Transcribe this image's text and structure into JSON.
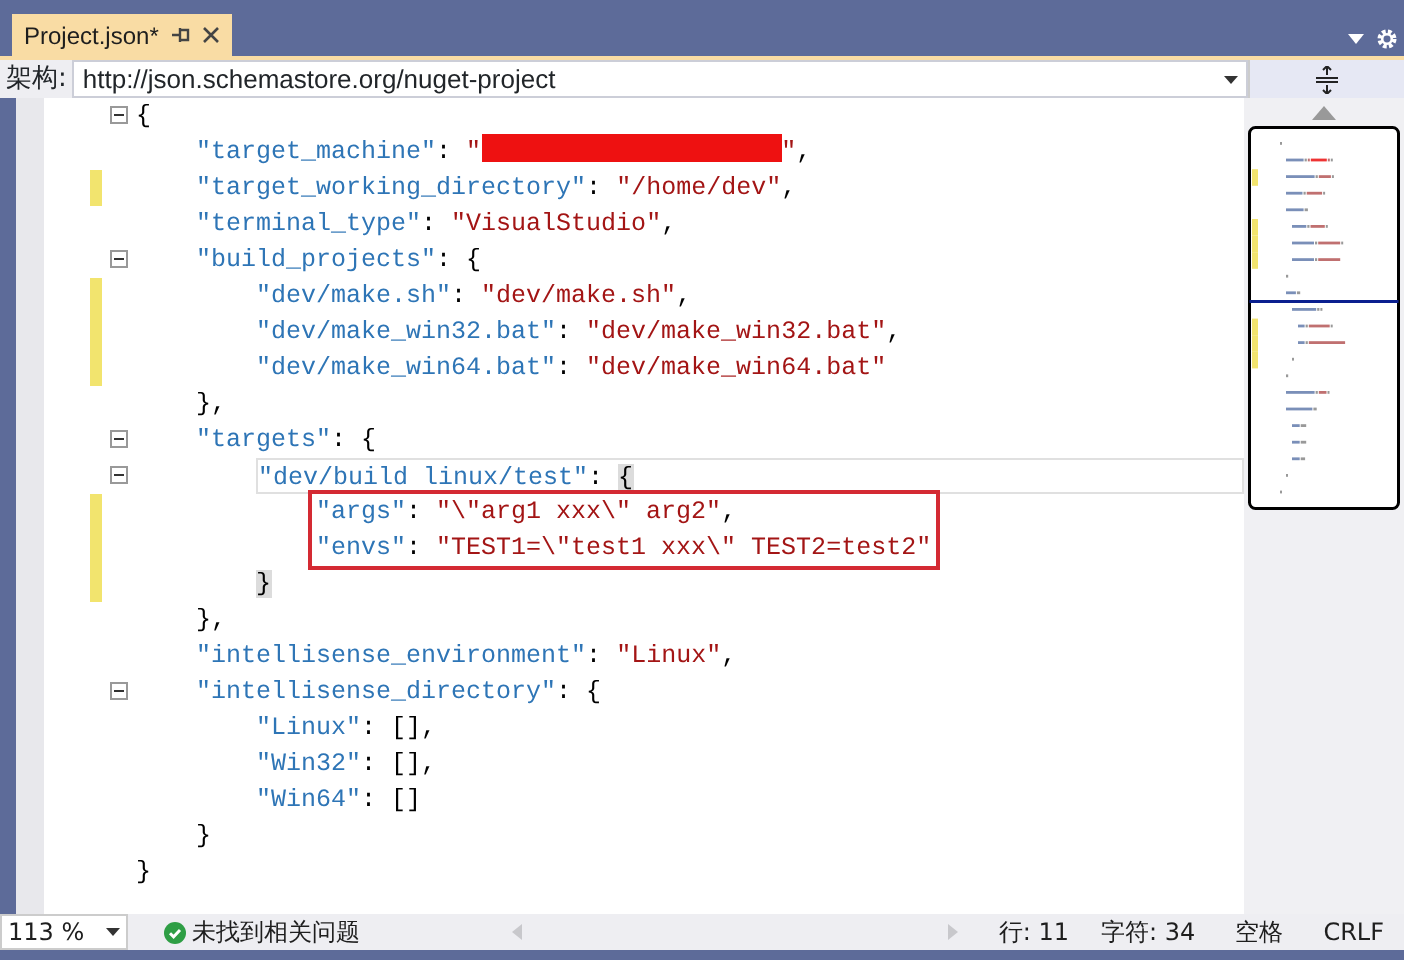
{
  "tab": {
    "title": "Project.json*"
  },
  "schema": {
    "label": "架构:",
    "value": "http://json.schemastore.org/nuget-project"
  },
  "code": {
    "lines": [
      {
        "fold": true,
        "changed": false,
        "current": false,
        "boxed": false,
        "tokens": [
          {
            "kind": "punct",
            "text": "{"
          }
        ],
        "children": [
          {
            "fold": false,
            "changed": false,
            "current": false,
            "boxed": false,
            "tokens": [
              {
                "kind": "key",
                "text": "\"target_machine\""
              },
              {
                "kind": "punct",
                "text": ": "
              },
              {
                "kind": "string",
                "text": "\""
              },
              {
                "kind": "redacted"
              },
              {
                "kind": "string",
                "text": "\""
              },
              {
                "kind": "punct",
                "text": ","
              }
            ]
          },
          {
            "fold": false,
            "changed": true,
            "current": false,
            "boxed": false,
            "tokens": [
              {
                "kind": "key",
                "text": "\"target_working_directory\""
              },
              {
                "kind": "punct",
                "text": ": "
              },
              {
                "kind": "string",
                "text": "\"/home/dev\""
              },
              {
                "kind": "punct",
                "text": ","
              }
            ]
          },
          {
            "fold": false,
            "changed": false,
            "current": false,
            "boxed": false,
            "tokens": [
              {
                "kind": "key",
                "text": "\"terminal_type\""
              },
              {
                "kind": "punct",
                "text": ": "
              },
              {
                "kind": "string",
                "text": "\"VisualStudio\""
              },
              {
                "kind": "punct",
                "text": ","
              }
            ]
          },
          {
            "fold": true,
            "changed": false,
            "current": false,
            "boxed": false,
            "tokens": [
              {
                "kind": "key",
                "text": "\"build_projects\""
              },
              {
                "kind": "punct",
                "text": ": {"
              }
            ],
            "children": [
              {
                "fold": false,
                "changed": true,
                "current": false,
                "boxed": false,
                "tokens": [
                  {
                    "kind": "key",
                    "text": "\"dev/make.sh\""
                  },
                  {
                    "kind": "punct",
                    "text": ": "
                  },
                  {
                    "kind": "string",
                    "text": "\"dev/make.sh\""
                  },
                  {
                    "kind": "punct",
                    "text": ","
                  }
                ]
              },
              {
                "fold": false,
                "changed": true,
                "current": false,
                "boxed": false,
                "tokens": [
                  {
                    "kind": "key",
                    "text": "\"dev/make_win32.bat\""
                  },
                  {
                    "kind": "punct",
                    "text": ": "
                  },
                  {
                    "kind": "string",
                    "text": "\"dev/make_win32.bat\""
                  },
                  {
                    "kind": "punct",
                    "text": ","
                  }
                ]
              },
              {
                "fold": false,
                "changed": true,
                "current": false,
                "boxed": false,
                "tokens": [
                  {
                    "kind": "key",
                    "text": "\"dev/make_win64.bat\""
                  },
                  {
                    "kind": "punct",
                    "text": ": "
                  },
                  {
                    "kind": "string",
                    "text": "\"dev/make_win64.bat\""
                  }
                ]
              }
            ]
          },
          {
            "fold": false,
            "changed": false,
            "current": false,
            "boxed": false,
            "tokens": [
              {
                "kind": "punct",
                "text": "},"
              }
            ]
          },
          {
            "fold": true,
            "changed": false,
            "current": false,
            "boxed": false,
            "tokens": [
              {
                "kind": "key",
                "text": "\"targets\""
              },
              {
                "kind": "punct",
                "text": ": {"
              }
            ],
            "children": [
              {
                "fold": true,
                "changed": false,
                "current": true,
                "boxed": false,
                "tokens": [
                  {
                    "kind": "key",
                    "text": "\"dev/build linux/test\""
                  },
                  {
                    "kind": "punct",
                    "text": ": "
                  },
                  {
                    "kind": "punct",
                    "text": "{",
                    "brace_match": true
                  }
                ],
                "children": [
                  {
                    "fold": false,
                    "changed": true,
                    "current": false,
                    "boxed": true,
                    "tokens": [
                      {
                        "kind": "key",
                        "text": "\"args\""
                      },
                      {
                        "kind": "punct",
                        "text": ": "
                      },
                      {
                        "kind": "string",
                        "text": "\"\\\"arg1 xxx\\\" arg2\""
                      },
                      {
                        "kind": "punct",
                        "text": ","
                      }
                    ]
                  },
                  {
                    "fold": false,
                    "changed": true,
                    "current": false,
                    "boxed": true,
                    "tokens": [
                      {
                        "kind": "key",
                        "text": "\"envs\""
                      },
                      {
                        "kind": "punct",
                        "text": ": "
                      },
                      {
                        "kind": "string",
                        "text": "\"TEST1=\\\"test1 xxx\\\" TEST2=test2\""
                      }
                    ]
                  }
                ]
              },
              {
                "fold": false,
                "changed": true,
                "current": false,
                "boxed": false,
                "tokens": [
                  {
                    "kind": "punct",
                    "text": "}",
                    "brace_match": true
                  }
                ]
              }
            ]
          },
          {
            "fold": false,
            "changed": false,
            "current": false,
            "boxed": false,
            "tokens": [
              {
                "kind": "punct",
                "text": "},"
              }
            ]
          },
          {
            "fold": false,
            "changed": false,
            "current": false,
            "boxed": false,
            "tokens": [
              {
                "kind": "key",
                "text": "\"intellisense_environment\""
              },
              {
                "kind": "punct",
                "text": ": "
              },
              {
                "kind": "string",
                "text": "\"Linux\""
              },
              {
                "kind": "punct",
                "text": ","
              }
            ]
          },
          {
            "fold": true,
            "changed": false,
            "current": false,
            "boxed": false,
            "tokens": [
              {
                "kind": "key",
                "text": "\"intellisense_directory\""
              },
              {
                "kind": "punct",
                "text": ": {"
              }
            ],
            "children": [
              {
                "fold": false,
                "changed": false,
                "current": false,
                "boxed": false,
                "tokens": [
                  {
                    "kind": "key",
                    "text": "\"Linux\""
                  },
                  {
                    "kind": "punct",
                    "text": ": [],"
                  }
                ]
              },
              {
                "fold": false,
                "changed": false,
                "current": false,
                "boxed": false,
                "tokens": [
                  {
                    "kind": "key",
                    "text": "\"Win32\""
                  },
                  {
                    "kind": "punct",
                    "text": ": [],"
                  }
                ]
              },
              {
                "fold": false,
                "changed": false,
                "current": false,
                "boxed": false,
                "tokens": [
                  {
                    "kind": "key",
                    "text": "\"Win64\""
                  },
                  {
                    "kind": "punct",
                    "text": ": []"
                  }
                ]
              }
            ]
          },
          {
            "fold": false,
            "changed": false,
            "current": false,
            "boxed": false,
            "tokens": [
              {
                "kind": "punct",
                "text": "}"
              }
            ]
          }
        ]
      },
      {
        "fold": false,
        "changed": false,
        "current": false,
        "boxed": false,
        "tokens": [
          {
            "kind": "punct",
            "text": "}"
          }
        ]
      }
    ]
  },
  "status": {
    "zoom": "113 %",
    "issues": "未找到相关问题",
    "line": "行: 11",
    "column": "字符: 34",
    "indent_mode": "空格",
    "line_ending": "CRLF"
  }
}
